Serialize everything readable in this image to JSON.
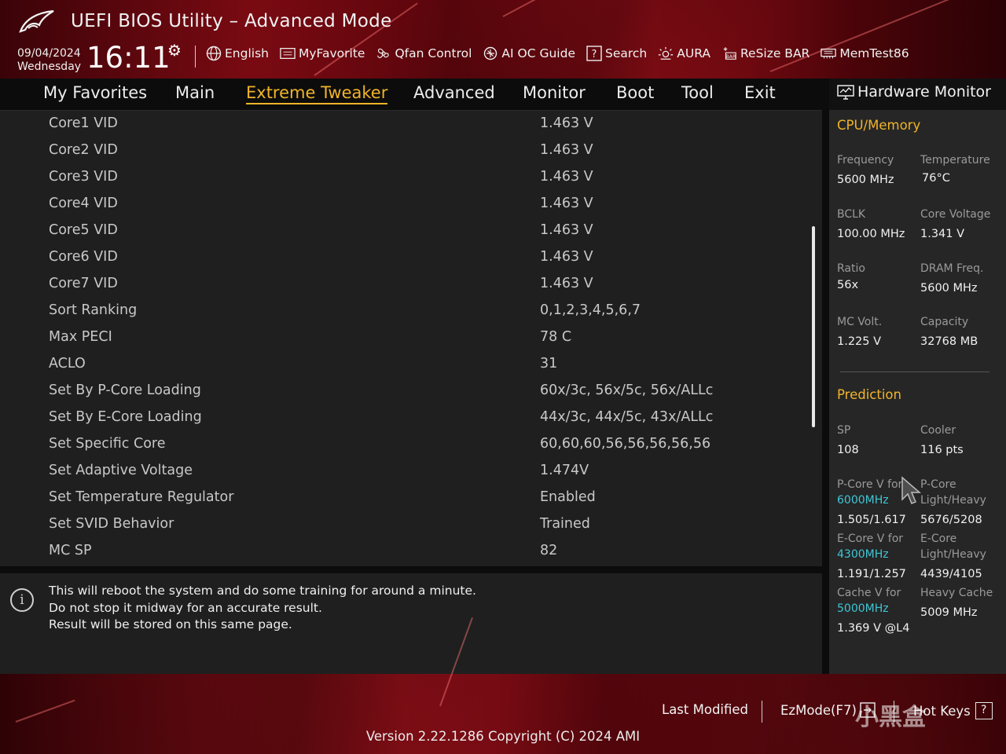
{
  "header": {
    "title": "UEFI BIOS Utility – Advanced Mode",
    "date": "09/04/2024",
    "weekday": "Wednesday",
    "time": "16:11",
    "toolbar": [
      {
        "label": "English",
        "icon": "globe-icon"
      },
      {
        "label": "MyFavorite",
        "icon": "favorite-list-icon"
      },
      {
        "label": "Qfan Control",
        "icon": "fan-icon"
      },
      {
        "label": "AI OC Guide",
        "icon": "ai-oc-icon"
      },
      {
        "label": "Search",
        "icon": "search-question-icon"
      },
      {
        "label": "AURA",
        "icon": "aura-icon"
      },
      {
        "label": "ReSize BAR",
        "icon": "resize-bar-icon"
      },
      {
        "label": "MemTest86",
        "icon": "memtest-icon"
      }
    ]
  },
  "nav": {
    "tabs": [
      {
        "label": "My Favorites"
      },
      {
        "label": "Main"
      },
      {
        "label": "Extreme Tweaker"
      },
      {
        "label": "Advanced"
      },
      {
        "label": "Monitor"
      },
      {
        "label": "Boot"
      },
      {
        "label": "Tool"
      },
      {
        "label": "Exit"
      }
    ],
    "active_index": 2
  },
  "settings": [
    {
      "label": "Core1 VID",
      "value": "1.463 V"
    },
    {
      "label": "Core2 VID",
      "value": "1.463 V"
    },
    {
      "label": "Core3 VID",
      "value": "1.463 V"
    },
    {
      "label": "Core4 VID",
      "value": "1.463 V"
    },
    {
      "label": "Core5 VID",
      "value": "1.463 V"
    },
    {
      "label": "Core6 VID",
      "value": "1.463 V"
    },
    {
      "label": "Core7 VID",
      "value": "1.463 V"
    },
    {
      "label": "Sort Ranking",
      "value": "0,1,2,3,4,5,6,7"
    },
    {
      "label": "Max PECI",
      "value": "78 C"
    },
    {
      "label": "ACLO",
      "value": "31"
    },
    {
      "label": "Set By P-Core Loading",
      "value": "60x/3c, 56x/5c, 56x/ALLc"
    },
    {
      "label": "Set By E-Core Loading",
      "value": "44x/3c, 44x/5c, 43x/ALLc"
    },
    {
      "label": "Set Specific Core",
      "value": "60,60,60,56,56,56,56,56"
    },
    {
      "label": "Set Adaptive Voltage",
      "value": "1.474V"
    },
    {
      "label": "Set Temperature Regulator",
      "value": "Enabled"
    },
    {
      "label": "Set SVID Behavior",
      "value": "Trained"
    },
    {
      "label": "MC SP",
      "value": "82"
    }
  ],
  "help": {
    "lines": [
      "This will reboot the system and do some training for around a minute.",
      "Do not stop it midway for an accurate result.",
      "Result will be stored on this same page."
    ]
  },
  "hw_monitor": {
    "title": "Hardware Monitor",
    "cpu_memory": {
      "section": "CPU/Memory",
      "frequency": {
        "label": "Frequency",
        "value": "5600 MHz"
      },
      "temperature": {
        "label": "Temperature",
        "value": "76°C"
      },
      "bclk": {
        "label": "BCLK",
        "value": "100.00 MHz"
      },
      "core_voltage": {
        "label": "Core Voltage",
        "value": "1.341 V"
      },
      "ratio": {
        "label": "Ratio",
        "value": "56x"
      },
      "dram_freq": {
        "label": "DRAM Freq.",
        "value": "5600 MHz"
      },
      "mc_volt": {
        "label": "MC Volt.",
        "value": "1.225 V"
      },
      "capacity": {
        "label": "Capacity",
        "value": "32768 MB"
      }
    },
    "prediction": {
      "section": "Prediction",
      "sp": {
        "label": "SP",
        "value": "108"
      },
      "cooler": {
        "label": "Cooler",
        "value": "116 pts"
      },
      "pcore_v": {
        "label": "P-Core V for",
        "freq": "6000MHz",
        "value": "1.505/1.617"
      },
      "pcore_lh": {
        "label1": "P-Core",
        "label2": "Light/Heavy",
        "value": "5676/5208"
      },
      "ecore_v": {
        "label": "E-Core V for",
        "freq": "4300MHz",
        "value": "1.191/1.257"
      },
      "ecore_lh": {
        "label1": "E-Core",
        "label2": "Light/Heavy",
        "value": "4439/4105"
      },
      "cache_v": {
        "label": "Cache V for",
        "freq": "5000MHz",
        "value": "1.369 V @L4"
      },
      "heavy_cache": {
        "label": "Heavy Cache",
        "value": "5009 MHz"
      }
    }
  },
  "footer": {
    "last_modified": "Last Modified",
    "ezmode": "EzMode(F7)",
    "hotkeys": "Hot Keys",
    "hotkeys_key": "?",
    "version": "Version 2.22.1286 Copyright (C) 2024 AMI",
    "watermark": "小黑盒"
  },
  "colors": {
    "accent": "#f0b429",
    "highlight_cyan": "#3fc6d6",
    "header_red": "#7a0a12"
  }
}
